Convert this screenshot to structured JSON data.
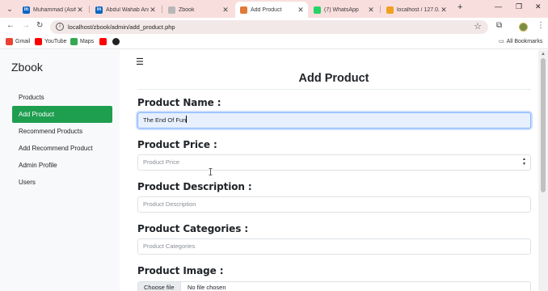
{
  "browser": {
    "tabs": [
      {
        "title": "Muhammad (Asif...",
        "fav_color": "#0a66c2",
        "fav_text": "in"
      },
      {
        "title": "Abdul Wahab Ans...",
        "fav_color": "#0a66c2",
        "fav_text": "in"
      },
      {
        "title": "Zbook",
        "fav_color": "#b7b7b7",
        "fav_text": ""
      },
      {
        "title": "Add Product",
        "fav_color": "#e07b39",
        "fav_text": ""
      },
      {
        "title": "(7) WhatsApp",
        "fav_color": "#25d366",
        "fav_text": ""
      },
      {
        "title": "localhost / 127.0...",
        "fav_color": "#f0a020",
        "fav_text": ""
      }
    ],
    "active_tab_index": 3,
    "url": "localhost/zbook/admin/add_product.php",
    "bookmarks": [
      {
        "label": "Gmail",
        "color": "#ea4335"
      },
      {
        "label": "YouTube",
        "color": "#ff0000"
      },
      {
        "label": "Maps",
        "color": "#34a853"
      },
      {
        "label": "",
        "color": "#ff0000"
      },
      {
        "label": "",
        "color": "#222222"
      }
    ],
    "all_bookmarks_label": "All Bookmarks"
  },
  "sidebar": {
    "brand": "Zbook",
    "items": [
      {
        "label": "Products",
        "active": false
      },
      {
        "label": "Add Product",
        "active": true
      },
      {
        "label": "Recommend Products",
        "active": false
      },
      {
        "label": "Add Recommend Product",
        "active": false
      },
      {
        "label": "Admin Profile",
        "active": false
      },
      {
        "label": "Users",
        "active": false
      }
    ],
    "accent_color": "#1e9e4f"
  },
  "form": {
    "title": "Add Product",
    "name_label": "Product Name :",
    "name_value": "The End Of Fun",
    "price_label": "Product Price :",
    "price_placeholder": "Product Price",
    "description_label": "Product Description :",
    "description_placeholder": "Product Description",
    "categories_label": "Product Categories :",
    "categories_placeholder": "Product Categories",
    "image_label": "Product Image :",
    "choose_file_label": "Choose file",
    "no_file_text": "No file chosen"
  }
}
